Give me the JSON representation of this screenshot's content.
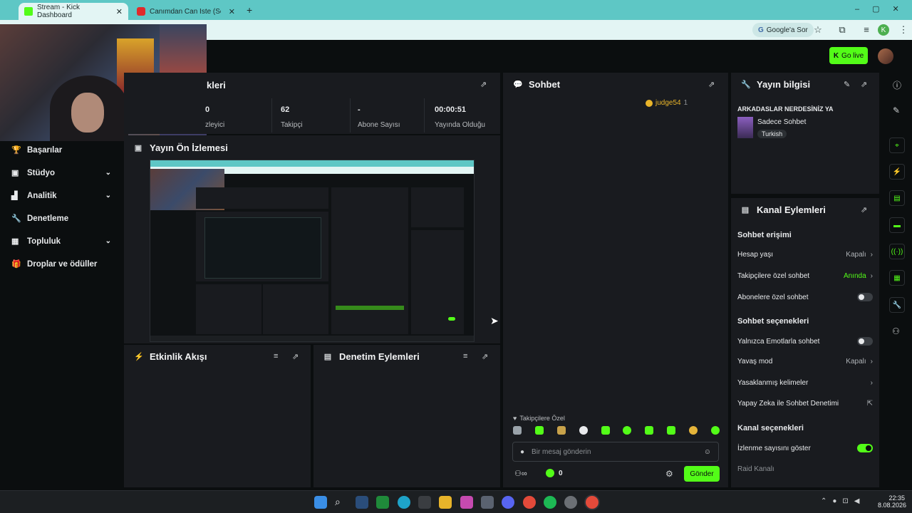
{
  "browser": {
    "tabs": [
      {
        "title": "Stream - Kick Dashboard",
        "active": true
      },
      {
        "title": "Canımdan Can İste (Senin İ",
        "active": false
      }
    ],
    "new_tab": "+",
    "google_chip": "Google'a Sor",
    "avatar_letter": "K"
  },
  "header": {
    "go_live": "Go live"
  },
  "sidebar": {
    "items": [
      {
        "label": "Başarılar",
        "icon": "trophy-icon",
        "chevron": false
      },
      {
        "label": "Stüdyo",
        "icon": "studio-icon",
        "chevron": true
      },
      {
        "label": "Analitik",
        "icon": "chart-icon",
        "chevron": true
      },
      {
        "label": "Denetleme",
        "icon": "wrench-icon",
        "chevron": false
      },
      {
        "label": "Topluluk",
        "icon": "community-icon",
        "chevron": true
      },
      {
        "label": "Droplar ve ödüller",
        "icon": "gift-icon",
        "chevron": false
      }
    ]
  },
  "stats_panel": {
    "title_partial": "kleri",
    "stats": [
      {
        "value": "0",
        "label": "zleyici"
      },
      {
        "value": "62",
        "label": "Takipçi"
      },
      {
        "value": "-",
        "label": "Abone Sayısı"
      },
      {
        "value": "00:00:51",
        "label": "Yayında Olduğu"
      }
    ]
  },
  "preview": {
    "title": "Yayın Ön İzlemesi"
  },
  "activity": {
    "title": "Etkinlik Akışı"
  },
  "mod_actions": {
    "title": "Denetim Eylemleri"
  },
  "chat": {
    "title": "Sohbet",
    "viewer_user": "judge54",
    "viewer_count": "1",
    "followers_only": "Takipçilere Özel",
    "input_placeholder": "Bir mesaj gönderin",
    "points": "0",
    "send_label": "Gönder"
  },
  "stream_info": {
    "title": "Yayın bilgisi",
    "stream_title": "ARKADASLAR NERDESİNİZ YA",
    "category": "Sadece Sohbet",
    "language": "Turkish"
  },
  "channel_actions": {
    "title": "Kanal Eylemleri",
    "chat_access": "Sohbet erişimi",
    "rows_access": [
      {
        "label": "Hesap yaşı",
        "value": "Kapalı",
        "kind": "chevron"
      },
      {
        "label": "Takipçilere özel sohbet",
        "value": "Anında",
        "kind": "chevron-green"
      },
      {
        "label": "Abonelere özel sohbet",
        "value": "",
        "kind": "toggle-off"
      }
    ],
    "chat_options": "Sohbet seçenekleri",
    "rows_options": [
      {
        "label": "Yalnızca Emotlarla sohbet",
        "value": "",
        "kind": "toggle-off"
      },
      {
        "label": "Yavaş mod",
        "value": "Kapalı",
        "kind": "chevron"
      },
      {
        "label": "Yasaklanmış kelimeler",
        "value": "",
        "kind": "chevron"
      },
      {
        "label": "Yapay Zeka ile Sohbet Denetimi",
        "value": "",
        "kind": "external"
      }
    ],
    "channel_options": "Kanal seçenekleri",
    "rows_channel": [
      {
        "label": "İzlenme sayısını göster",
        "value": "",
        "kind": "toggle-on"
      },
      {
        "label": "Raid Kanalı",
        "value": "",
        "kind": "dim"
      }
    ]
  },
  "taskbar": {
    "time": "22:35",
    "date": "8.08.2026"
  },
  "colors": {
    "accent": "#53fc18",
    "panel": "#191b1f",
    "background": "#0b0e0f",
    "browser": "#5ec7c5"
  }
}
